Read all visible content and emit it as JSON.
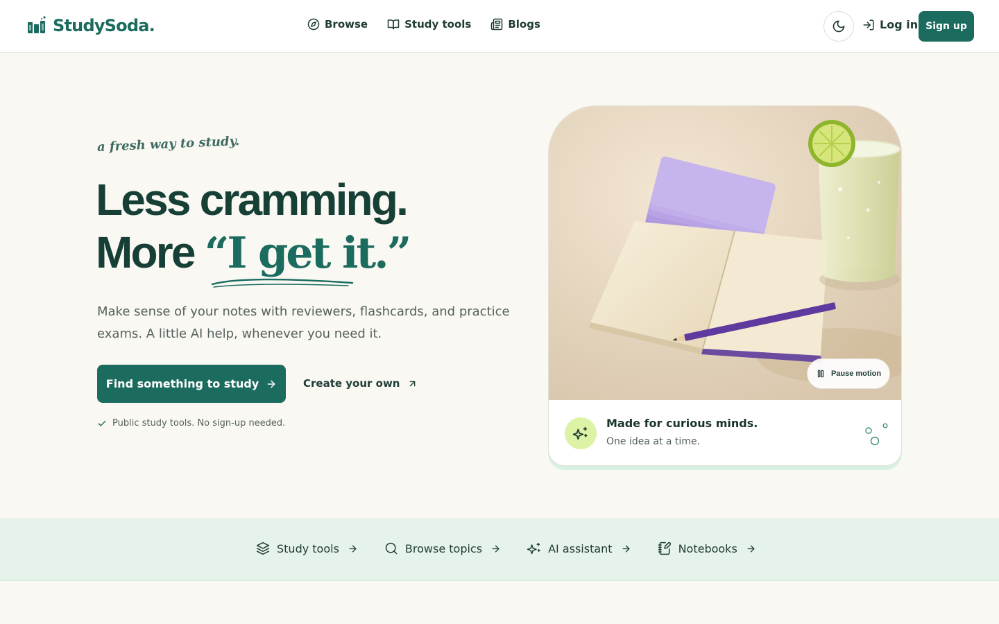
{
  "header": {
    "logo_text": "StudySoda.",
    "nav": [
      {
        "label": "Browse",
        "icon": "compass-icon"
      },
      {
        "label": "Study tools",
        "icon": "book-open-icon"
      },
      {
        "label": "Blogs",
        "icon": "newspaper-icon"
      }
    ],
    "theme_toggle_icon": "moon-icon",
    "login_label": "Log in",
    "signup_label": "Sign up"
  },
  "hero": {
    "tagline": "a fresh way to study.",
    "headline_line1": "Less cramming.",
    "headline_line2_prefix": "More",
    "headline_line2_accent": "“I get it.”",
    "subtext": "Make sense of your notes with reviewers, flashcards, and practice exams. A little AI help, whenever you need it.",
    "primary_cta": "Find something to study",
    "secondary_cta": "Create your own",
    "note": "Public study tools. No sign-up needed."
  },
  "card": {
    "pause_label": "Pause motion",
    "title": "Made for curious minds.",
    "subtitle": "One idea at a time."
  },
  "quicklinks": [
    {
      "label": "Study tools",
      "icon": "layers-icon"
    },
    {
      "label": "Browse topics",
      "icon": "search-icon"
    },
    {
      "label": "AI assistant",
      "icon": "sparkles-icon"
    },
    {
      "label": "Notebooks",
      "icon": "notebook-pen-icon"
    }
  ],
  "colors": {
    "brand": "#1b6b5e",
    "page_bg": "#faf8f3",
    "strip_bg": "#e6f3ea",
    "badge_bg": "#dcf2a4"
  }
}
